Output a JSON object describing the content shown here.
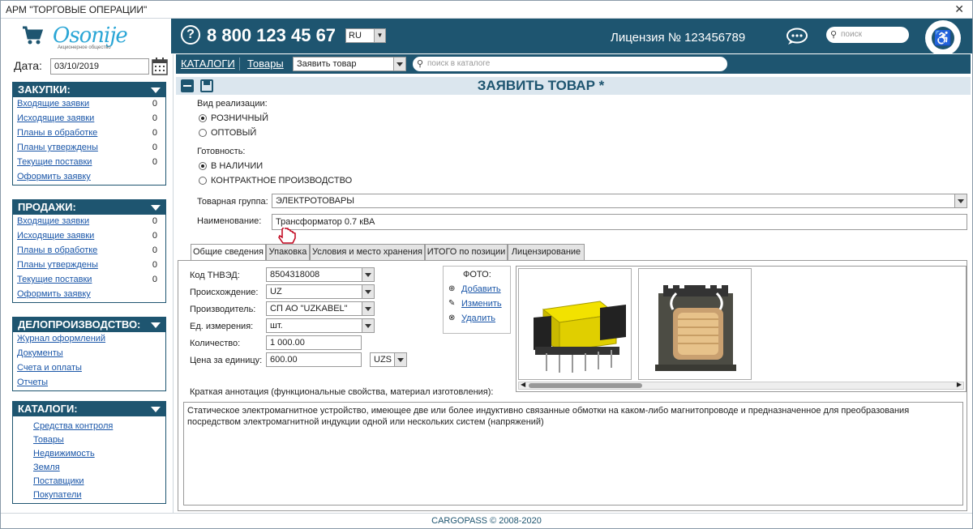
{
  "window": {
    "title": "АРМ \"ТОРГОВЫЕ ОПЕРАЦИИ\"",
    "close": "✕"
  },
  "header": {
    "brand": "Osonije",
    "brand_sub": "Акционерное общество",
    "phone": "8 800 123 45 67",
    "lang": "RU",
    "license": "Лицензия № 123456789",
    "search_placeholder": "поиск"
  },
  "sidebar": {
    "date_label": "Дата:",
    "date_value": "03/10/2019",
    "purchases": {
      "title": "ЗАКУПКИ:",
      "items": [
        {
          "label": "Входящие заявки",
          "count": "0"
        },
        {
          "label": "Исходящие заявки",
          "count": "0"
        },
        {
          "label": "Планы в обработке",
          "count": "0"
        },
        {
          "label": "Планы утверждены",
          "count": "0"
        },
        {
          "label": "Текущие поставки",
          "count": "0"
        },
        {
          "label": "Оформить заявку",
          "count": ""
        }
      ]
    },
    "sales": {
      "title": "ПРОДАЖИ:",
      "items": [
        {
          "label": "Входящие заявки",
          "count": "0"
        },
        {
          "label": "Исходящие заявки",
          "count": "0"
        },
        {
          "label": "Планы в обработке",
          "count": "0"
        },
        {
          "label": "Планы утверждены",
          "count": "0"
        },
        {
          "label": "Текущие поставки",
          "count": "0"
        },
        {
          "label": "Оформить заявку",
          "count": ""
        }
      ]
    },
    "records": {
      "title": "ДЕЛОПРОИЗВОДСТВО:",
      "items": [
        {
          "label": "Журнал оформлений"
        },
        {
          "label": "Документы"
        },
        {
          "label": "Счета и оплаты"
        },
        {
          "label": "Отчеты"
        }
      ]
    },
    "catalogs": {
      "title": "КАТАЛОГИ:",
      "items": [
        {
          "label": "Средства контроля"
        },
        {
          "label": "Товары"
        },
        {
          "label": "Недвижимость"
        },
        {
          "label": "Земля"
        },
        {
          "label": "Поставщики"
        },
        {
          "label": "Покупатели"
        }
      ]
    }
  },
  "nav": {
    "catalogs": "КАТАЛОГИ",
    "goods": "Товары",
    "action": "Заявить товар",
    "search_placeholder": "поиск в каталоге"
  },
  "form": {
    "title": "ЗАЯВИТЬ ТОВАР *",
    "sale_type_label": "Вид реализации:",
    "sale_retail": "РОЗНИЧНЫЙ",
    "sale_wholesale": "ОПТОВЫЙ",
    "ready_label": "Готовность:",
    "ready_stock": "В НАЛИЧИИ",
    "ready_contract": "КОНТРАКТНОЕ ПРОИЗВОДСТВО",
    "group_label": "Товарная группа:",
    "group_value": "ЭЛЕКТРОТОВАРЫ",
    "name_label": "Наименование:",
    "name_value": "Трансформатор 0.7 кВА"
  },
  "tabs": [
    "Общие сведения",
    "Упаковка",
    "Условия и место хранения",
    "ИТОГО по позиции",
    "Лицензирование"
  ],
  "general": {
    "tnved_label": "Код ТНВЭД:",
    "tnved_value": "8504318008",
    "origin_label": "Происхождение:",
    "origin_value": "UZ",
    "maker_label": "Производитель:",
    "maker_value": "СП АО \"UZKABEL\"",
    "unit_label": "Ед. измерения:",
    "unit_value": "шт.",
    "qty_label": "Количество:",
    "qty_value": "1 000.00",
    "price_label": "Цена за единицу:",
    "price_value": "600.00",
    "currency": "UZS",
    "photo_title": "ФОТО:",
    "photo_add": "Добавить",
    "photo_edit": "Изменить",
    "photo_delete": "Удалить",
    "annot_label": "Краткая аннотация (функциональные свойства, материал изготовления):",
    "annot_text": "Статическое электромагнитное устройство, имеющее две или более индуктивно связанные обмотки на каком-либо магнитопроводе и предназначенное для преобразования посредством электромагнитной индукции одной или нескольких систем (напряжений)"
  },
  "footer": {
    "text": "CARGOPASS © 2008-2020"
  },
  "colors": {
    "accent": "#1e5570",
    "link": "#1a56a8"
  }
}
